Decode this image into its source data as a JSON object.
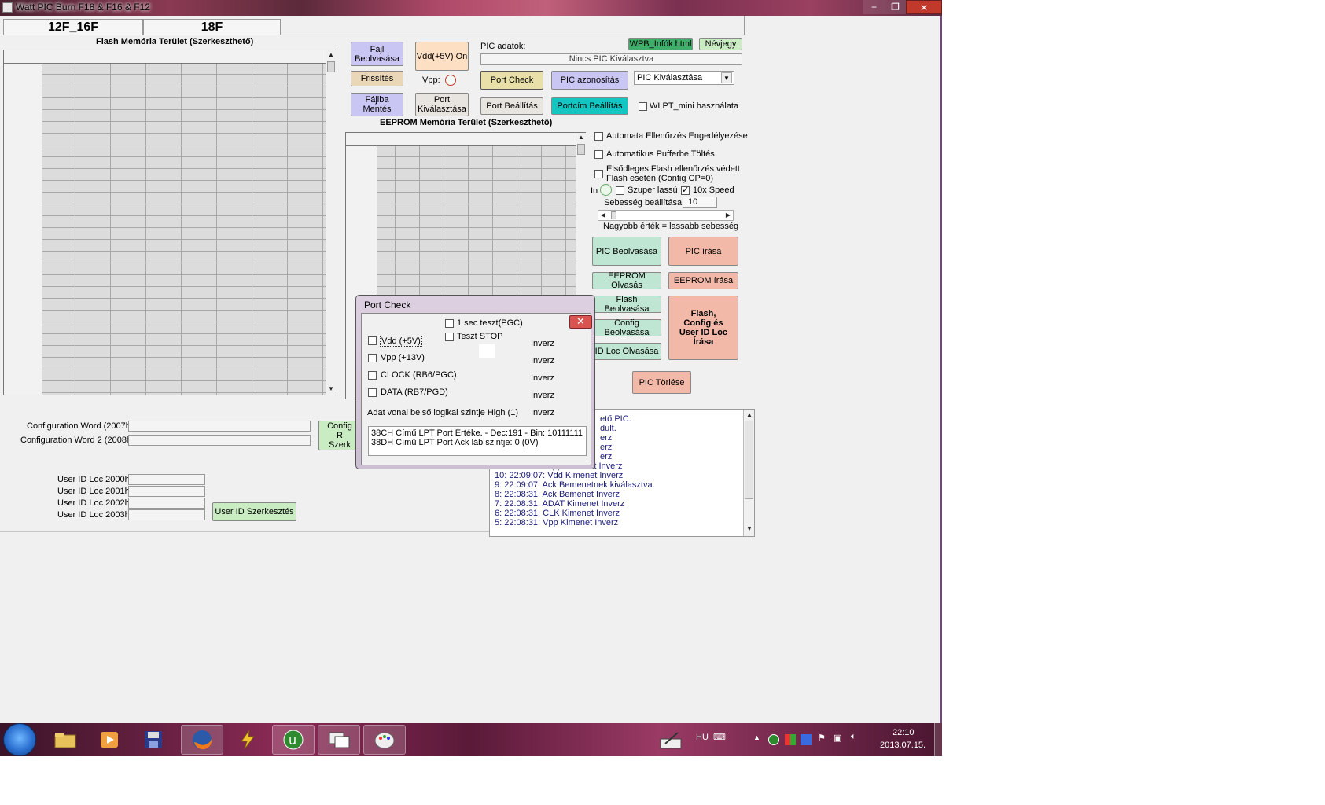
{
  "window": {
    "title": "Watt PIC Burn F18 & F16 & F12",
    "minimize": "−",
    "maximize": "❐",
    "close": "✕"
  },
  "tabs": [
    "12F_16F",
    "18F"
  ],
  "flash_grid": {
    "label": "Flash Memória Terület (Szerkeszthető)"
  },
  "eeprom_grid": {
    "label": "EEPROM Memória Terület (Szerkeszthető)"
  },
  "left_buttons": {
    "fajl_beolvasasa": "Fájl\nBeolvasása",
    "vdd_on": "Vdd(+5V) On",
    "frissites": "Frissítés",
    "vpp_label": "Vpp:",
    "fajlba_mentes": "Fájlba\nMentés",
    "port_kivalasztasa": "Port\nKiválasztása"
  },
  "pic": {
    "adatok_label": "PIC adatok:",
    "wpb_button": "WPB_Infók html",
    "nevjegy_button": "Névjegy",
    "selected_text": "Nincs PIC Kiválasztva",
    "port_check": "Port Check",
    "pic_azonositas": "PIC azonosítás",
    "pic_select": "PIC Kiválasztása",
    "port_beallitas": "Port Beállítás",
    "portcim_beallitas": "Portcím Beállítás",
    "wlpt_mini": "WLPT_mini használata"
  },
  "options": {
    "auto_check": "Automata Ellenőrzés Engedélyezése",
    "auto_buffer": "Automatikus Pufferbe Töltés",
    "primary_flash_1": "Elsődleges Flash ellenőrzés védett",
    "primary_flash_2": "Flash esetén (Config CP=0)",
    "in_label": "In",
    "super_slow": "Szuper lassú",
    "speed10x": "10x Speed",
    "speed_label": "Sebesség beállítása :",
    "speed_value": "10",
    "speed_note": "Nagyobb érték = lassabb sebesség"
  },
  "actions": {
    "pic_beolvasasa": "PIC Beolvasása",
    "pic_irasa": "PIC   írása",
    "eeprom_olvasas": "EEPROM Olvasás",
    "eeprom_irasa": "EEPROM írása",
    "flash_beolvasasa": "Flash Beolvasása",
    "config_beolvasasa": "Config Beolvasása",
    "idloc_olvasasa": "ID Loc Olvasása",
    "flash_config_write": "Flash,\nConfig és\nUser ID Loc\nÍrása",
    "pic_torlese": "PIC  Törlése"
  },
  "config": {
    "word1_label": "Configuration Word (2007h):",
    "word2_label": "Configuration Word 2 (2008h):",
    "config_button": "Config R\nSzerk"
  },
  "userid": {
    "loc0": "User ID Loc 2000h",
    "loc1": "User ID Loc 2001h",
    "loc2": "User ID Loc 2002h",
    "loc3": "User ID Loc 2003h",
    "edit_button": "User ID Szerkesztés"
  },
  "log": {
    "lines": [
      "ető PIC.",
      "dult.",
      "erz",
      "erz",
      "erz",
      "11:  22:09:07:  Vpp Kimenet Inverz",
      "10:  22:09:07:  Vdd Kimenet Inverz",
      "9:  22:09:07:  Ack Bemenetnek kiválasztva.",
      "8:  22:08:31:  Ack Bemenet Inverz",
      "7:  22:08:31:  ADAT Kimenet Inverz",
      "6:  22:08:31:  CLK Kimenet Inverz",
      "5:  22:08:31:  Vpp Kimenet Inverz"
    ]
  },
  "dialog": {
    "title": "Port Check",
    "close": "✕",
    "test_1sec": "1 sec teszt(PGC)",
    "test_stop": "Teszt STOP",
    "lines": [
      {
        "label": "Vdd (+5V)",
        "inverz": "Inverz"
      },
      {
        "label": "Vpp (+13V)",
        "inverz": "Inverz"
      },
      {
        "label": "CLOCK (RB6/PGC)",
        "inverz": "Inverz"
      },
      {
        "label": "DATA (RB7/PGD)",
        "inverz": "Inverz"
      }
    ],
    "logic_level": "Adat vonal belső logikai szintje High (1)",
    "logic_inverz": "Inverz",
    "out1": "38CH Című LPT Port Értéke. - Dec:191 - Bin: 10111111",
    "out2": "38DH Című LPT Port Ack láb szintje: 0 (0V)"
  },
  "taskbar": {
    "language": "HU",
    "time": "22:10",
    "date": "2013.07.15."
  }
}
